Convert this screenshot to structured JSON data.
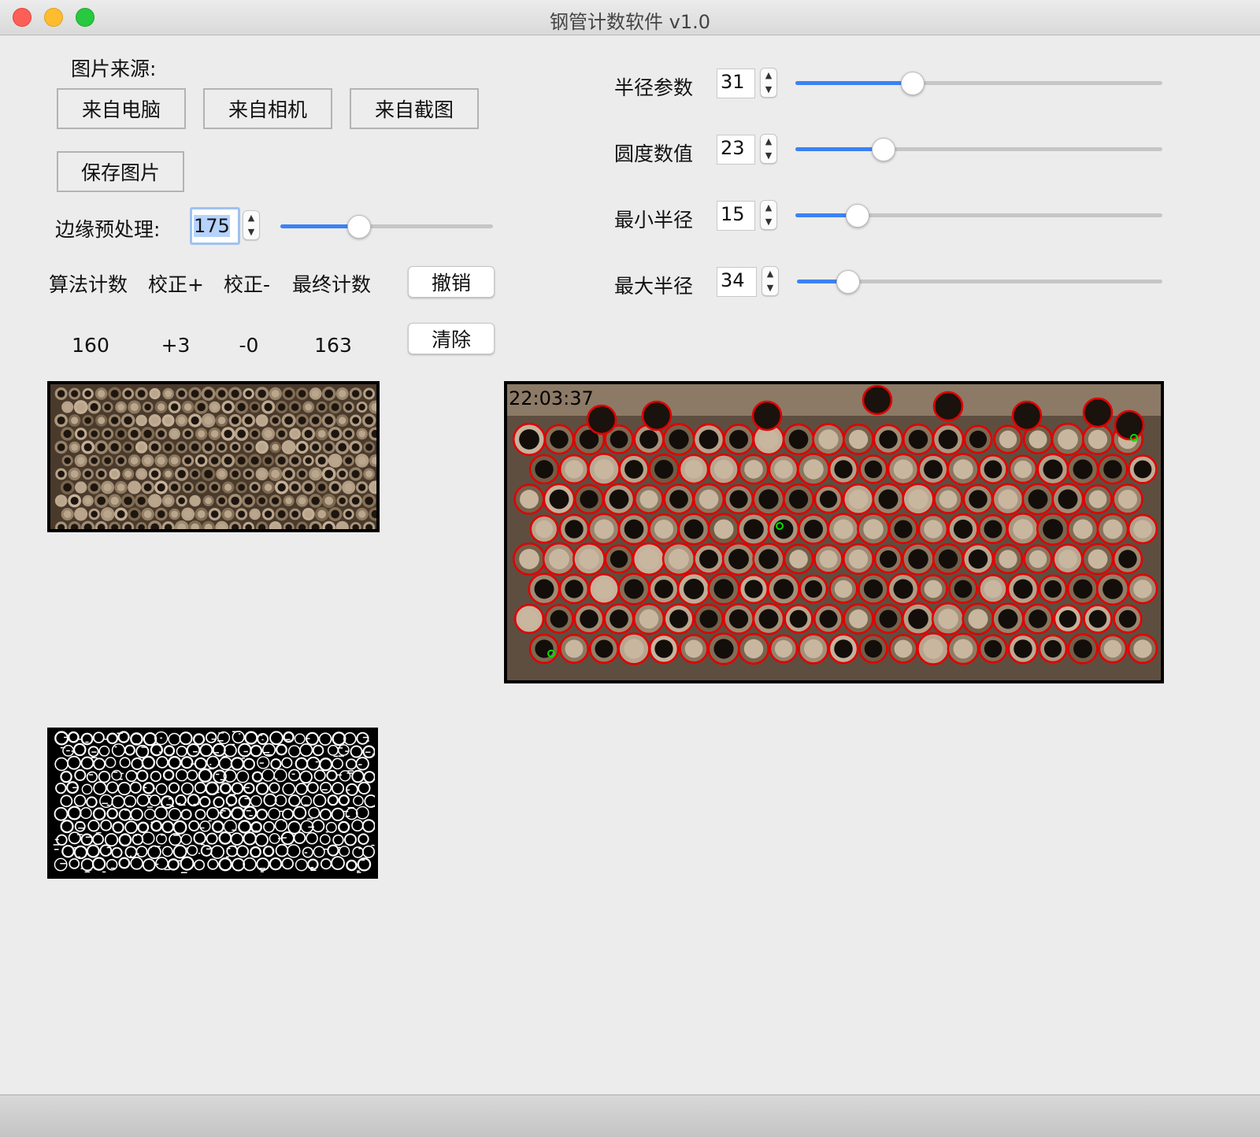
{
  "window": {
    "title": "钢管计数软件 v1.0"
  },
  "source": {
    "label": "图片来源:",
    "btn_pc": "来自电脑",
    "btn_camera": "来自相机",
    "btn_screenshot": "来自截图",
    "btn_save": "保存图片"
  },
  "edge": {
    "label": "边缘预处理:",
    "value": "175",
    "level_percent": 37
  },
  "counts": {
    "headers": [
      "算法计数",
      "校正+",
      "校正-",
      "最终计数"
    ],
    "values": [
      "160",
      "+3",
      "-0",
      "163"
    ]
  },
  "actions": {
    "undo": "撤销",
    "clear": "清除"
  },
  "params": [
    {
      "label": "半径参数",
      "value": "31",
      "level_percent": 32
    },
    {
      "label": "圆度数值",
      "value": "23",
      "level_percent": 24
    },
    {
      "label": "最小半径",
      "value": "15",
      "level_percent": 17
    },
    {
      "label": "最大半径",
      "value": "34",
      "level_percent": 14
    }
  ],
  "result": {
    "timestamp": "22:03:37"
  },
  "colors": {
    "accent": "#3b82f6",
    "circle": "#e10000",
    "marker": "#00e000"
  },
  "icons": {
    "spin_up": "chevron-up-icon",
    "spin_down": "chevron-down-icon"
  }
}
